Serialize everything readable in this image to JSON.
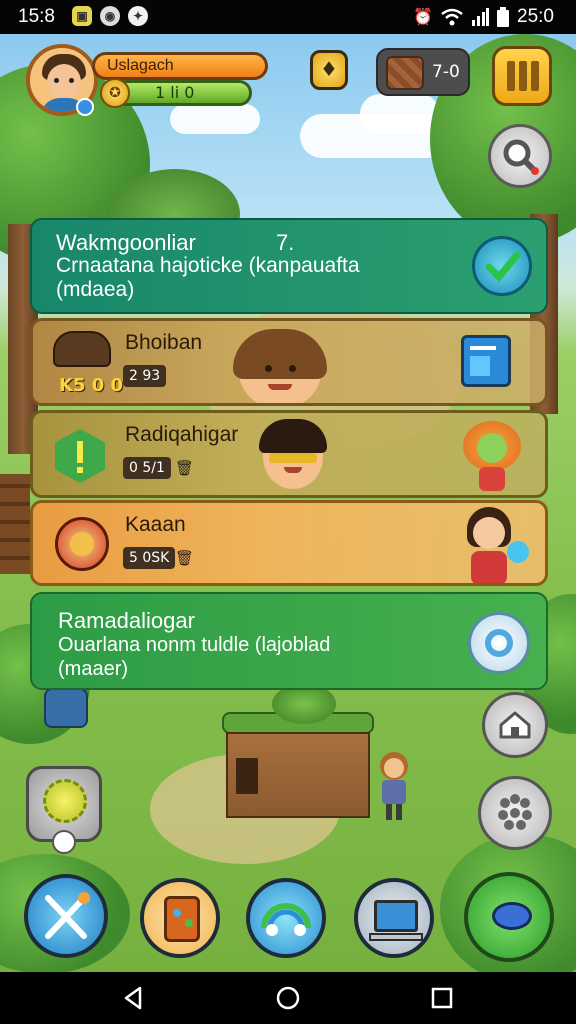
{
  "status_bar": {
    "time": "15:8",
    "right_text": "25:0",
    "icons": [
      "notification-icon",
      "notification-icon",
      "notification-icon",
      "alarm-icon",
      "wifi-icon",
      "signal-icon",
      "battery-icon"
    ]
  },
  "hud": {
    "player_name": "Uslagach",
    "level_text": "1 li 0",
    "resource_value": "7-0",
    "icons": [
      "avatar",
      "gem-icon",
      "wood-crate-icon",
      "menu-icon",
      "search-icon"
    ]
  },
  "cards": [
    {
      "title": "Wakmgoonliar",
      "title_num": "7.",
      "line1": "Crnaatana hajoticke (kanpauafta",
      "line2": "(mdaea)",
      "icon": "check-badge-icon"
    },
    {
      "name": "Bhoiban",
      "tag": "2 93",
      "badge": "K5 0 0",
      "icon": "tablet-icon"
    },
    {
      "name": "Radiqahigar",
      "tag": "0 5/1",
      "icon": "leaf-creature-icon"
    },
    {
      "name": "Kaaan",
      "tag": "5 0SK",
      "icon": "girl-character-icon"
    },
    {
      "title": "Ramadaliogar",
      "line1": "Ouarlana nonm tuldle (lajoblad",
      "line2": "(maaer)",
      "icon": "gear-icon"
    }
  ],
  "side_buttons": [
    "home-icon",
    "grid-dots-icon"
  ],
  "dock": [
    "crossed-swords-icon",
    "backpack-icon",
    "rainbow-icon",
    "computer-icon",
    "chat-bubble-icon"
  ],
  "navbar": [
    "back-icon",
    "home-nav-icon",
    "recents-icon"
  ],
  "colors": {
    "card_green": "#1f8f6c",
    "card_brown": "#b08744",
    "card_orange": "#e99c42",
    "card_green2": "#2d9c46",
    "accent_orange": "#f07f17"
  }
}
